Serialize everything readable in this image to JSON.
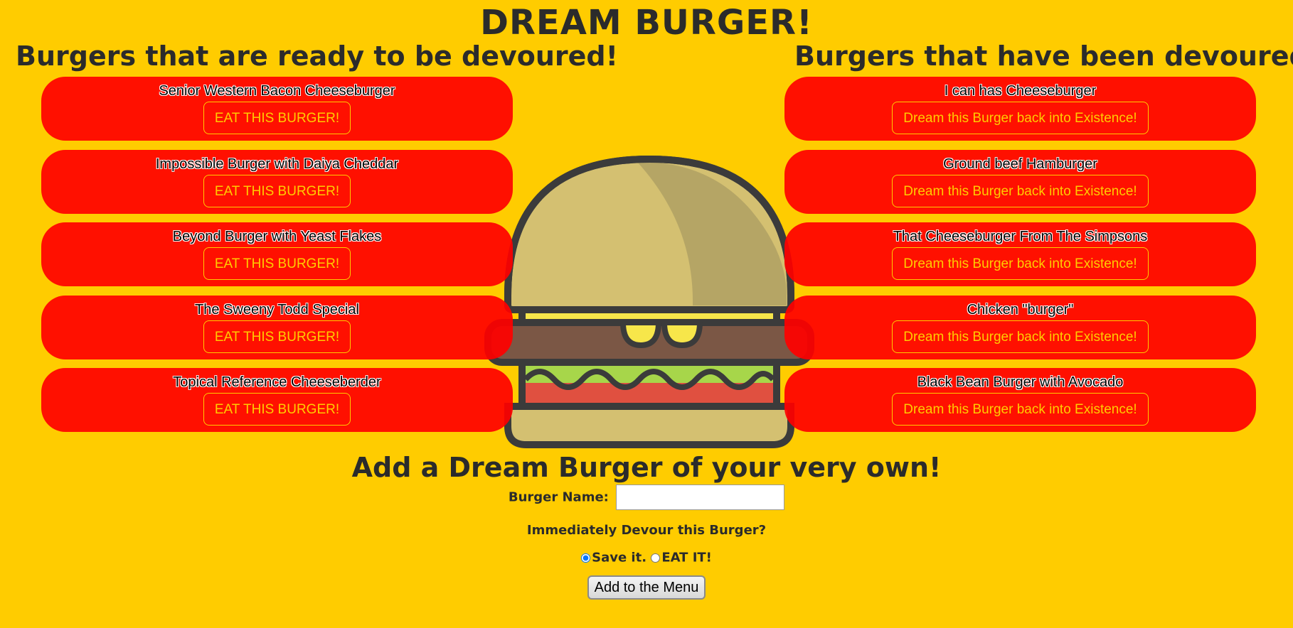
{
  "title": "DREAM BURGER!",
  "ready_heading": "Burgers that are ready to be devoured!",
  "devoured_heading": "Burgers that have been devoured!",
  "ready_burgers": [
    {
      "name": "Senior Western Bacon Cheeseburger",
      "button": "EAT THIS BURGER!"
    },
    {
      "name": "Impossible Burger with Daiya Cheddar",
      "button": "EAT THIS BURGER!"
    },
    {
      "name": "Beyond Burger with Yeast Flakes",
      "button": "EAT THIS BURGER!"
    },
    {
      "name": "The Sweeny Todd Special",
      "button": "EAT THIS BURGER!"
    },
    {
      "name": "Topical Reference Cheeseberder",
      "button": "EAT THIS BURGER!"
    }
  ],
  "devoured_burgers": [
    {
      "name": "I can has Cheeseburger",
      "button": "Dream this Burger back into Existence!"
    },
    {
      "name": "Ground beef Hamburger",
      "button": "Dream this Burger back into Existence!"
    },
    {
      "name": "That Cheeseburger From The Simpsons",
      "button": "Dream this Burger back into Existence!"
    },
    {
      "name": "Chicken \"burger\"",
      "button": "Dream this Burger back into Existence!"
    },
    {
      "name": "Black Bean Burger with Avocado",
      "button": "Dream this Burger back into Existence!"
    }
  ],
  "form": {
    "heading": "Add a Dream Burger of your very own!",
    "name_label": "Burger Name:",
    "name_value": "",
    "devour_question": "Immediately Devour this Burger?",
    "options": [
      {
        "label": "Save it.",
        "selected": true
      },
      {
        "label": "EAT IT!",
        "selected": false
      }
    ],
    "submit_label": "Add to the Menu"
  },
  "colors": {
    "background": "#ffcc00",
    "card": "#ff0000",
    "button_text": "#ffcc00",
    "heading_text": "#2b2b2b"
  },
  "icons": {
    "background_art": "burger-icon"
  }
}
